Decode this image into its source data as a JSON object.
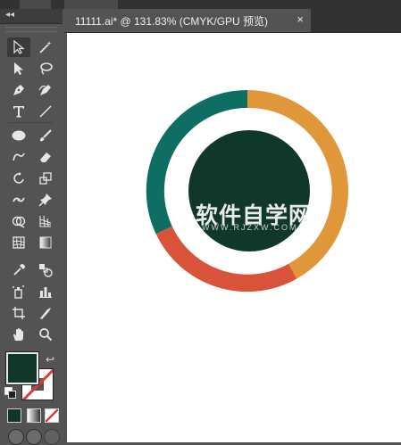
{
  "app": {
    "document_tab": {
      "title": "11111.ai* @ 131.83% (CMYK/GPU 预览)",
      "close_glyph": "×"
    },
    "toolbar": {
      "collapse_glyph": "◂◂",
      "tools": [
        "selection-tool",
        "magic-wand-tool",
        "direct-selection-tool",
        "lasso-tool",
        "pen-tool",
        "curvature-tool",
        "type-tool",
        "line-segment-tool",
        "ellipse-tool",
        "paintbrush-tool",
        "shaper-tool",
        "eraser-tool",
        "rotate-tool",
        "scale-tool",
        "puppet-warp-tool",
        "free-transform-tool",
        "shape-builder-tool",
        "perspective-grid-tool",
        "mesh-tool",
        "gradient-tool",
        "eyedropper-tool",
        "blend-tool",
        "symbol-sprayer-tool",
        "column-graph-tool",
        "artboard-tool",
        "slice-tool",
        "hand-tool",
        "zoom-tool"
      ],
      "fill_color": "#11362a",
      "stroke_color": "none"
    }
  },
  "artwork": {
    "colors": {
      "orange": "#e0973a",
      "red": "#d9523a",
      "teal": "#0f6e63",
      "center": "#11362a"
    },
    "watermark": {
      "main": "软件自学网",
      "sub": "WWW.RJZXW.COM"
    }
  }
}
